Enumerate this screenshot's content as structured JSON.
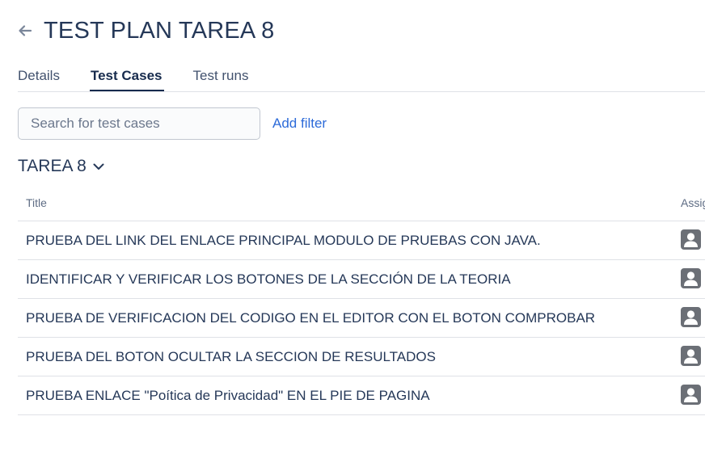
{
  "header": {
    "title": "TEST PLAN TAREA 8",
    "back_icon": "arrow-left-icon"
  },
  "tabs": [
    {
      "label": "Details",
      "active": false
    },
    {
      "label": "Test Cases",
      "active": true
    },
    {
      "label": "Test runs",
      "active": false
    }
  ],
  "search": {
    "placeholder": "Search for test cases",
    "value": ""
  },
  "filter": {
    "add_label": "Add filter"
  },
  "folder": {
    "title": "TAREA 8",
    "icon": "chevron-down-icon"
  },
  "table": {
    "columns": {
      "title": "Title",
      "assignee": "Assignee"
    },
    "rows": [
      {
        "title": "PRUEBA DEL LINK DEL ENLACE PRINCIPAL MODULO DE PRUEBAS CON JAVA.",
        "assignee_icon": "user-avatar-icon"
      },
      {
        "title": "IDENTIFICAR Y VERIFICAR LOS BOTONES DE LA SECCIÓN DE LA TEORIA",
        "assignee_icon": "user-avatar-icon"
      },
      {
        "title": "PRUEBA DE VERIFICACION DEL CODIGO EN EL EDITOR CON EL BOTON COMPROBAR",
        "assignee_icon": "user-avatar-icon"
      },
      {
        "title": "PRUEBA DEL BOTON OCULTAR LA SECCION DE RESULTADOS",
        "assignee_icon": "user-avatar-icon"
      },
      {
        "title": "PRUEBA ENLACE \"Poítica de Privacidad\" EN EL PIE DE PAGINA",
        "assignee_icon": "user-avatar-icon"
      }
    ]
  },
  "colors": {
    "accent_link": "#2d6bd9",
    "title_text": "#253858",
    "border": "#dfe1e6",
    "avatar_bg": "#6b6f76"
  }
}
